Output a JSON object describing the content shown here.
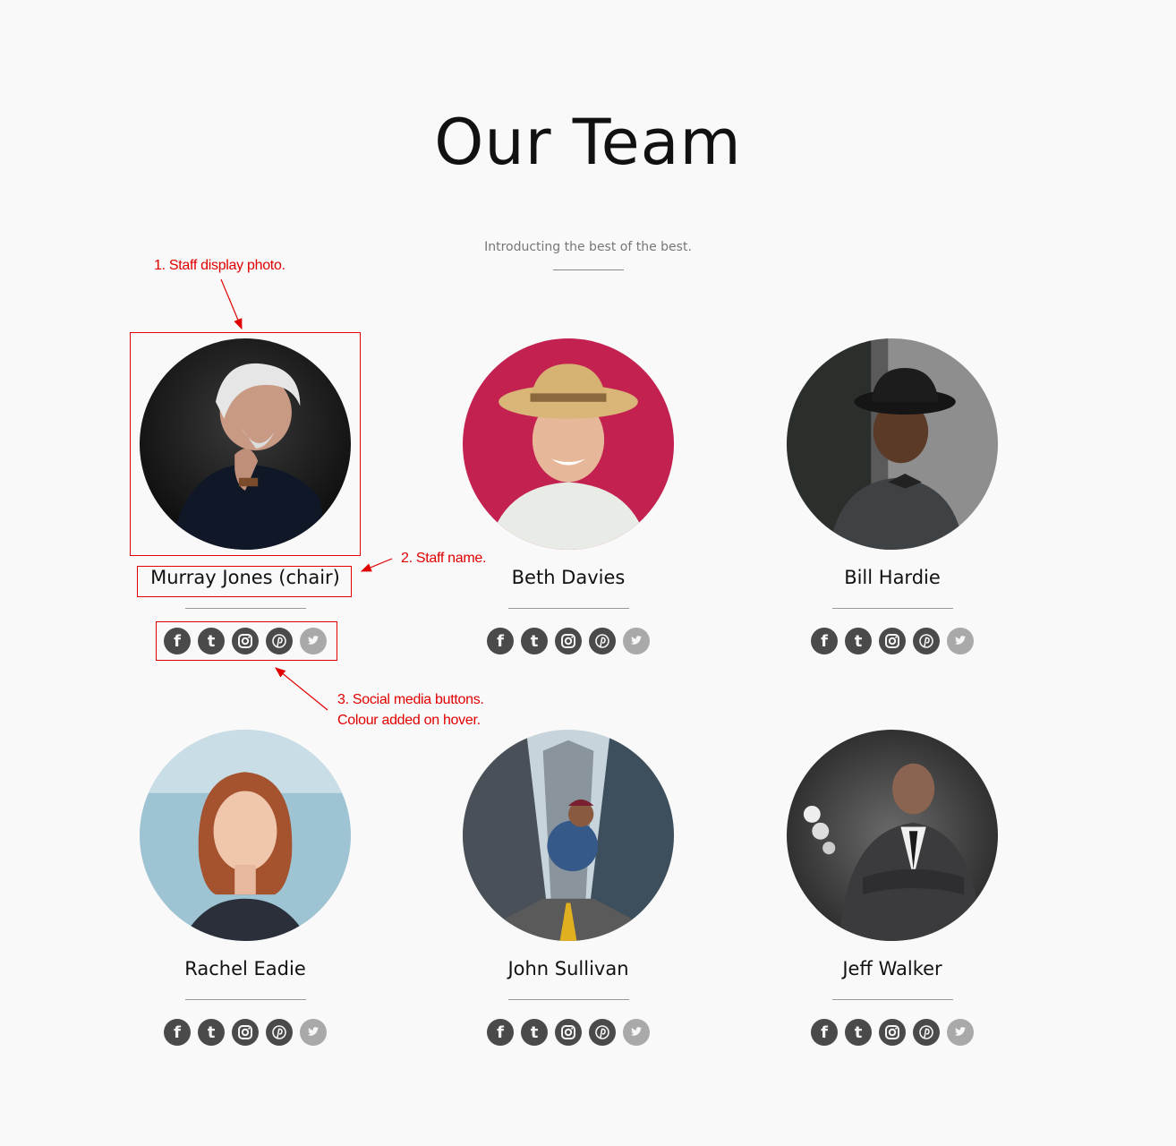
{
  "header": {
    "title": "Our Team",
    "subtitle": "Introducting the best of the best."
  },
  "team": [
    {
      "name": "Murray Jones (chair)",
      "photo": "portrait-older-man-white-hair"
    },
    {
      "name": "Beth Davies",
      "photo": "portrait-woman-straw-hat"
    },
    {
      "name": "Bill Hardie",
      "photo": "portrait-man-black-hat-glasses"
    },
    {
      "name": "Rachel Eadie",
      "photo": "portrait-young-woman-red-hair"
    },
    {
      "name": "John Sullivan",
      "photo": "portrait-man-street-skyscrapers"
    },
    {
      "name": "Jeff Walker",
      "photo": "portrait-man-suit-arms-crossed"
    }
  ],
  "social_icons": [
    "facebook-icon",
    "tumblr-icon",
    "instagram-icon",
    "pinterest-icon",
    "twitter-icon"
  ],
  "social_glyphs": {
    "facebook": "f",
    "tumblr": "t"
  },
  "annotations": {
    "photo": "1. Staff  display photo.",
    "name": "2. Staff  name.",
    "social_line1": "3. Social media buttons.",
    "social_line2": "Colour added on hover."
  },
  "colors": {
    "background": "#f9f9f9",
    "annotation": "#e00000",
    "icon": "#4a4a4a",
    "icon_twitter": "#a9a9a9"
  }
}
